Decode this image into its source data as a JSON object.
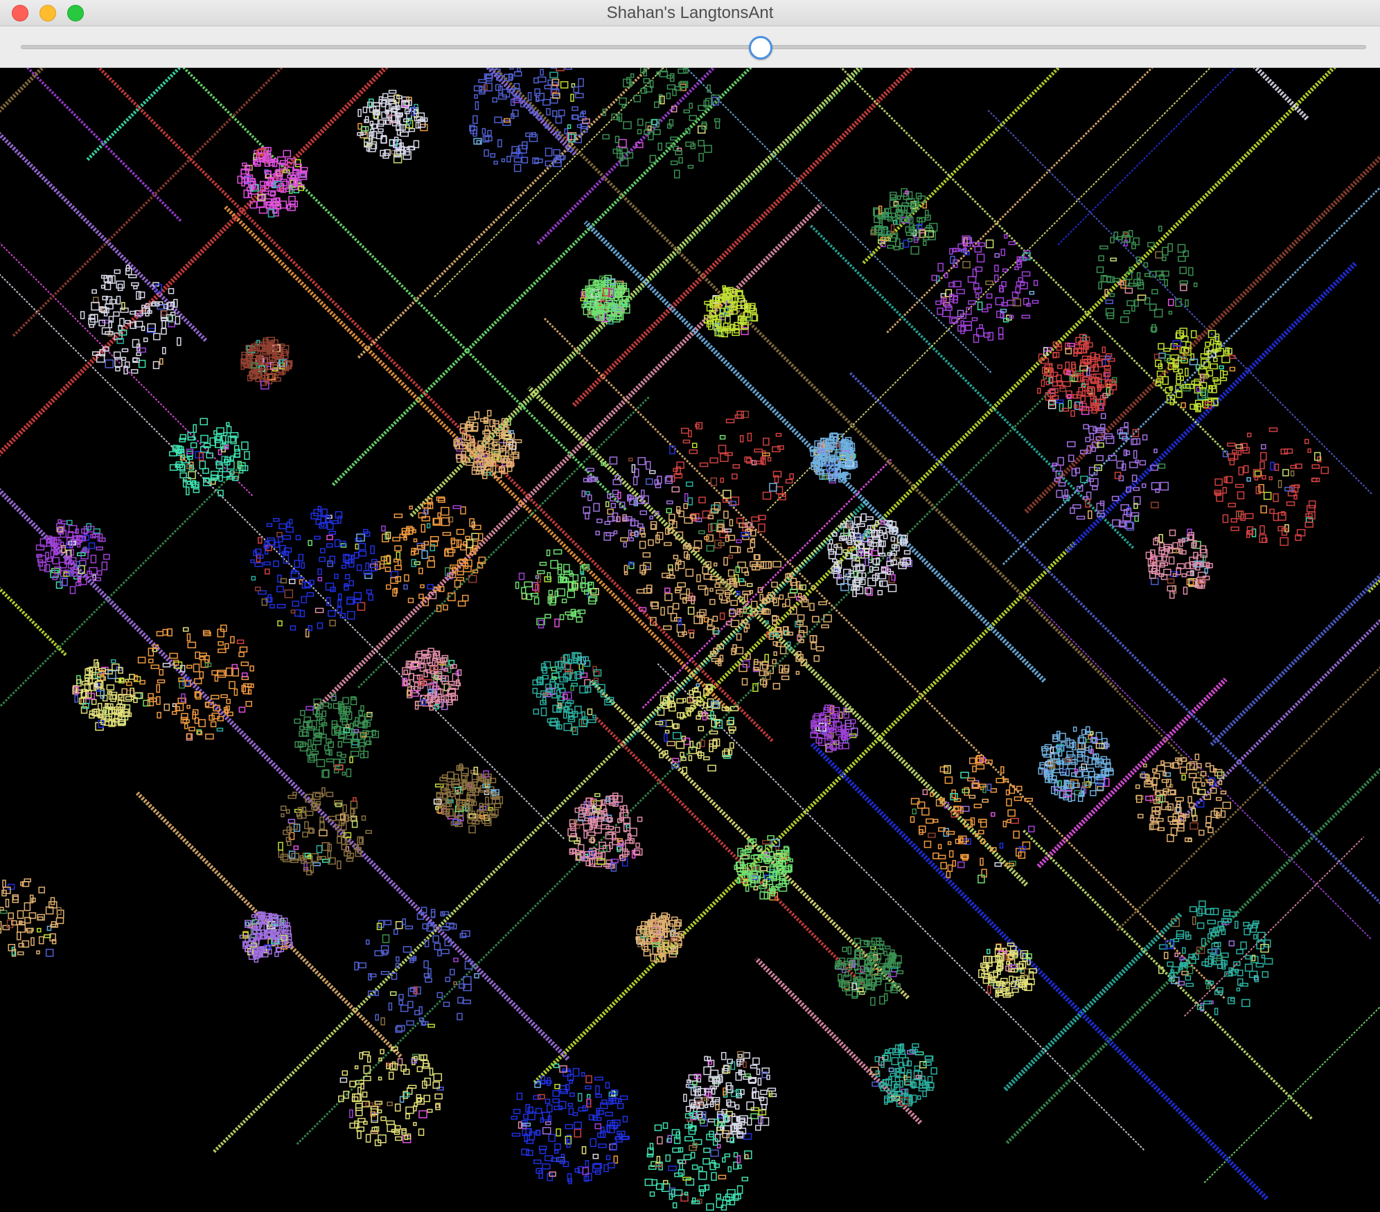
{
  "window": {
    "title": "Shahan's LangtonsAnt"
  },
  "controls": {
    "speed_slider_value": 0.55
  },
  "canvas": {
    "background": "#000000",
    "palette": [
      "#3fe0b0",
      "#e3e07a",
      "#c4e070",
      "#e08ea8",
      "#a040d8",
      "#3a8f52",
      "#5060d0",
      "#f09a40",
      "#d8d8e8",
      "#e050e0",
      "#6ee070",
      "#6fb0e0",
      "#c0e030",
      "#e0b070",
      "#d04040",
      "#904030",
      "#8a7040",
      "#2ab0a0",
      "#a070e0",
      "#2030e0"
    ]
  }
}
